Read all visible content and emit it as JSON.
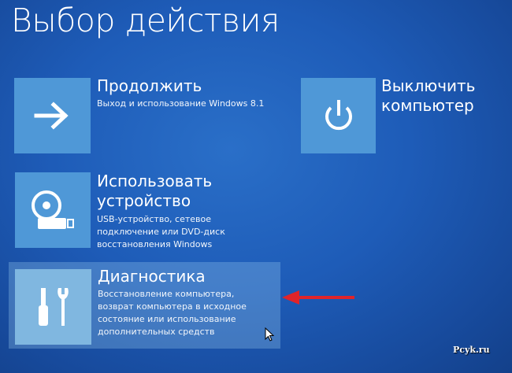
{
  "page": {
    "title": "Выбор действия"
  },
  "options": [
    {
      "title_lines": [
        "Продолжить"
      ],
      "description_lines": [
        "Выход и использование Windows 8.1"
      ],
      "icon": "arrow-right-icon"
    },
    {
      "title_lines": [
        "Выключить",
        "компьютер"
      ],
      "description_lines": [],
      "icon": "power-icon"
    },
    {
      "title_lines": [
        "Использовать",
        "устройство"
      ],
      "description_lines": [
        "USB-устройство, сетевое",
        "подключение или DVD-диск",
        "восстановления Windows"
      ],
      "icon": "disc-drive-icon"
    },
    {
      "title_lines": [
        "Диагностика"
      ],
      "description_lines": [
        "Восстановление компьютера,",
        "возврат компьютера в исходное",
        "состояние или использование",
        "дополнительных средств"
      ],
      "icon": "tools-icon"
    }
  ],
  "annotation": {
    "arrow": "red-arrow-icon",
    "arrow_color": "#e0242a"
  },
  "watermark": {
    "text": "Pcyk.ru"
  },
  "colors": {
    "background": "#1e5cb8",
    "tile": "#4f98d7",
    "highlight_tile": "#80b7e0"
  }
}
